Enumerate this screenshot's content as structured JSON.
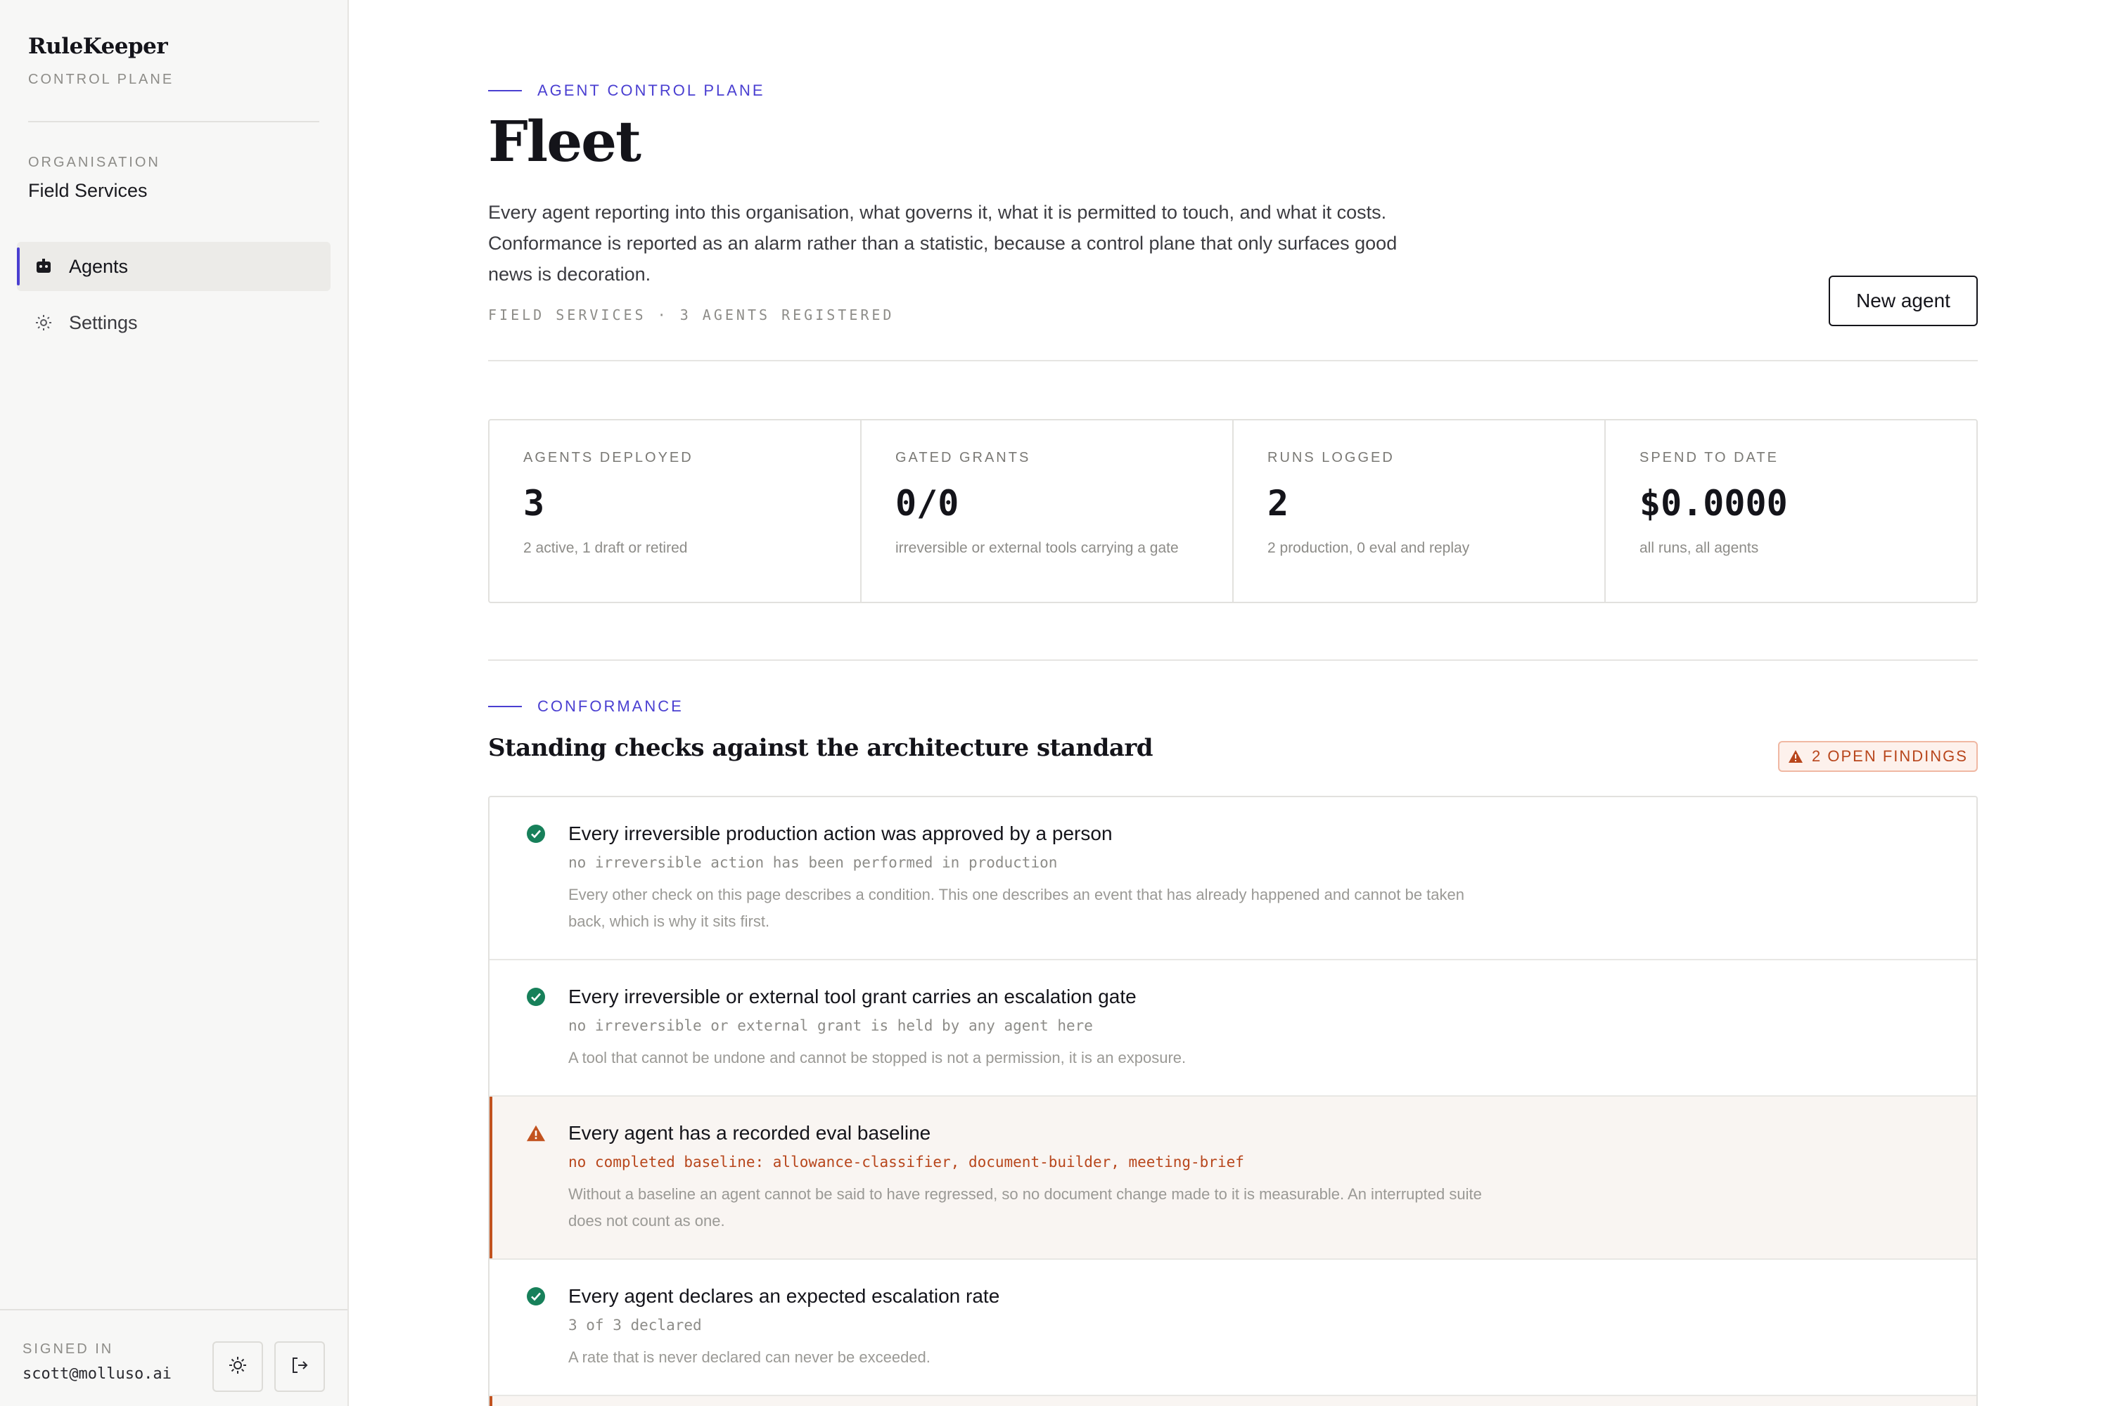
{
  "sidebar": {
    "brand_name": "RuleKeeper",
    "brand_sub": "CONTROL PLANE",
    "org_label": "ORGANISATION",
    "org_name": "Field Services",
    "nav": [
      {
        "label": "Agents",
        "icon": "agent-icon",
        "active": true
      },
      {
        "label": "Settings",
        "icon": "gear-icon",
        "active": false
      }
    ],
    "signed_in_label": "SIGNED IN",
    "signed_in_email": "scott@molluso.ai"
  },
  "header": {
    "eyebrow": "AGENT CONTROL PLANE",
    "title": "Fleet",
    "description": "Every agent reporting into this organisation, what governs it, what it is permitted to touch, and what it costs. Conformance is reported as an alarm rather than a statistic, because a control plane that only surfaces good news is decoration.",
    "meta": "FIELD SERVICES · 3 AGENTS REGISTERED",
    "new_agent_label": "New agent"
  },
  "stats": [
    {
      "label": "AGENTS DEPLOYED",
      "value": "3",
      "note": "2 active, 1 draft or retired"
    },
    {
      "label": "GATED GRANTS",
      "value": "0/0",
      "note": "irreversible or external tools carrying a gate"
    },
    {
      "label": "RUNS LOGGED",
      "value": "2",
      "note": "2 production, 0 eval and replay"
    },
    {
      "label": "SPEND TO DATE",
      "value": "$0.0000",
      "note": "all runs, all agents"
    }
  ],
  "conformance": {
    "eyebrow": "CONFORMANCE",
    "title": "Standing checks against the architecture standard",
    "findings_label": "2 OPEN FINDINGS",
    "checks": [
      {
        "status": "pass",
        "title": "Every irreversible production action was approved by a person",
        "detail": "no irreversible action has been performed in production",
        "description": "Every other check on this page describes a condition. This one describes an event that has already happened and cannot be taken back, which is why it sits first."
      },
      {
        "status": "pass",
        "title": "Every irreversible or external tool grant carries an escalation gate",
        "detail": "no irreversible or external grant is held by any agent here",
        "description": "A tool that cannot be undone and cannot be stopped is not a permission, it is an exposure."
      },
      {
        "status": "fail",
        "title": "Every agent has a recorded eval baseline",
        "detail": "no completed baseline: allowance-classifier, document-builder, meeting-brief",
        "description": "Without a baseline an agent cannot be said to have regressed, so no document change made to it is measurable. An interrupted suite does not count as one."
      },
      {
        "status": "pass",
        "title": "Every agent declares an expected escalation rate",
        "detail": "3 of 3 declared",
        "description": "A rate that is never declared can never be exceeded."
      }
    ]
  },
  "colors": {
    "accent": "#4a3fd1",
    "pass": "#17805a",
    "warn": "#b8461c"
  }
}
